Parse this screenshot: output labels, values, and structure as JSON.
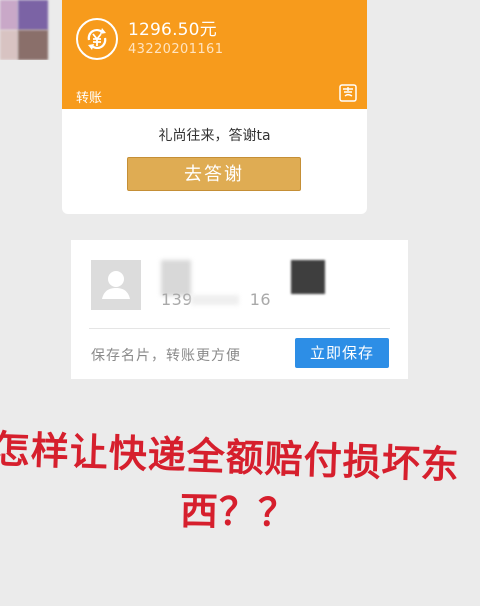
{
  "transfer": {
    "amount": "1296.50元",
    "account": "43220201161",
    "label": "转账",
    "thanks_prompt": "礼尚往来，答谢ta",
    "thanks_button": "去答谢"
  },
  "contact": {
    "phone": "139",
    "phone_suffix": "16",
    "hint": "保存名片，转账更方便",
    "save_button": "立即保存"
  },
  "overlay": {
    "line1": "怎样让快递全额赔付损坏东",
    "line2": "西？？"
  },
  "colors": {
    "orange": "#f79b1c",
    "gold_button": "#dfac53",
    "blue_button": "#2d8ee6",
    "red_text": "#d61f2d"
  }
}
